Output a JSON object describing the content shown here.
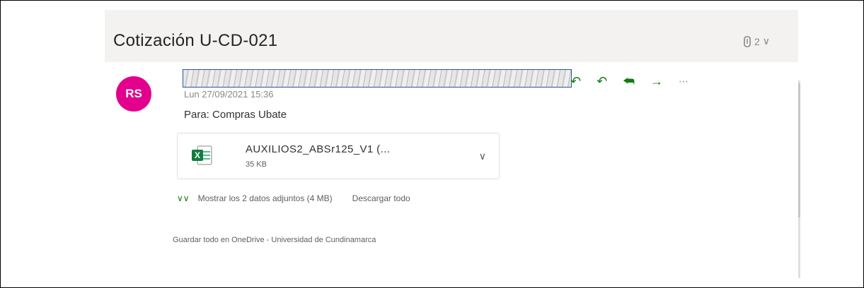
{
  "subject": "Cotización U-CD-021",
  "header": {
    "attachment_count": "2",
    "attachment_icon": "paperclip-icon"
  },
  "message": {
    "avatar_initials": "RS",
    "avatar_color": "#e3008c",
    "date": "Lun 27/09/2021 15:36",
    "to_line": "Para:  Compras Ubate"
  },
  "actions": {
    "reply_icon": "reply-icon",
    "reply_all_icon": "reply-all-icon",
    "forward_icon": "forward-icon",
    "more_icon": "more-icon",
    "accent_color": "#107c10"
  },
  "attachment": {
    "file_name": "AUXILIOS2_ABSr125_V1 (...",
    "file_size": "35 KB",
    "file_icon": "excel-icon"
  },
  "attachments_bar": {
    "show_label": "Mostrar los 2 datos adjuntos (4 MB)",
    "download_label": "Descargar todo",
    "onedrive_label": "Guardar todo en OneDrive - Universidad de Cundinamarca"
  }
}
